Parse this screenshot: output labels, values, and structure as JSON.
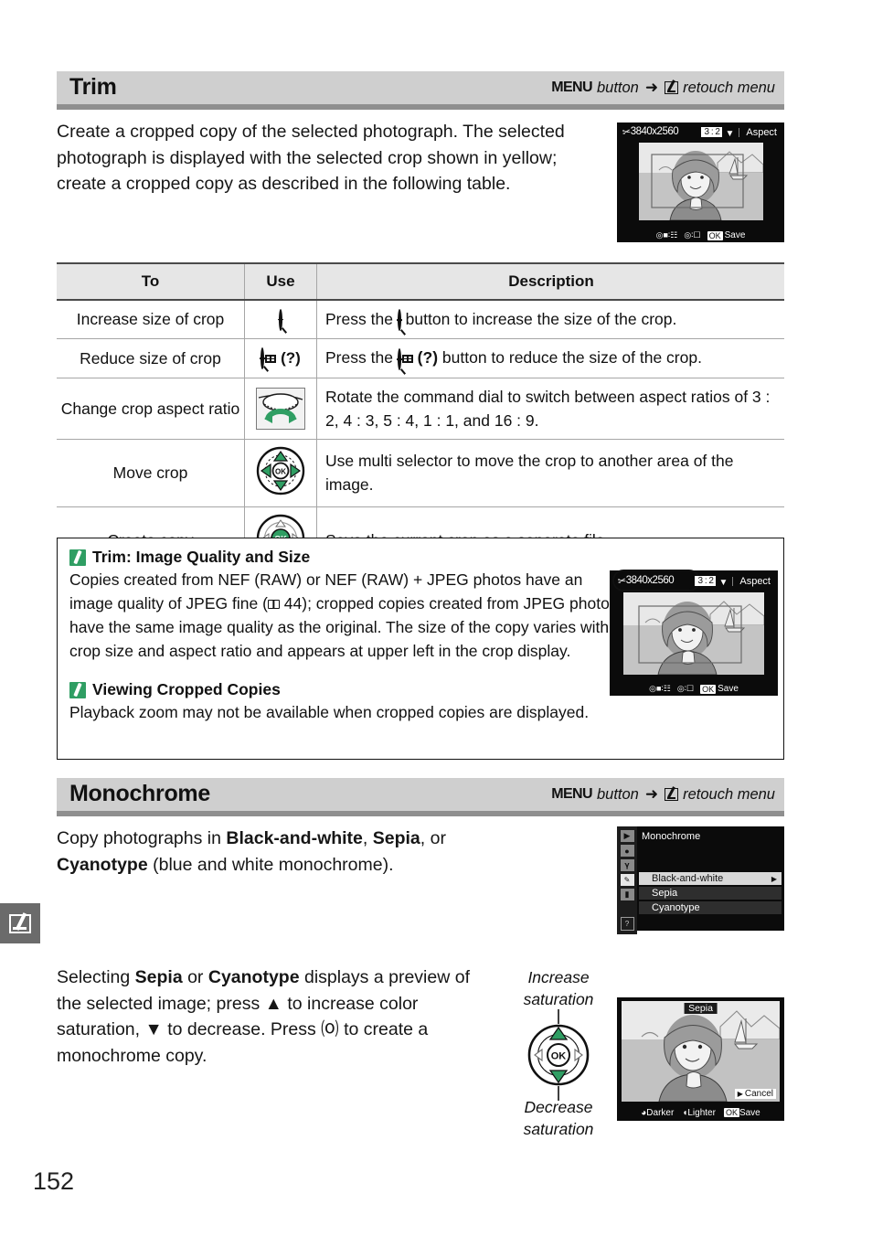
{
  "page": {
    "number": "152"
  },
  "sections": [
    {
      "title": "Trim",
      "route": {
        "menu": "MENU",
        "button_word": "button",
        "arrow": "➜",
        "target": "retouch menu"
      },
      "intro": "Create a cropped copy of the selected photograph.  The selected photograph is displayed with the selected crop shown in yellow; create a cropped copy as described in the following table."
    },
    {
      "title": "Monochrome",
      "route": {
        "menu": "MENU",
        "button_word": "button",
        "arrow": "➜",
        "target": "retouch menu"
      },
      "intro_pre": "Copy photographs in ",
      "intro_b1": "Black-and-white",
      "intro_mid1": ", ",
      "intro_b2": "Sepia",
      "intro_mid2": ", or ",
      "intro_b3": "Cyanotype",
      "intro_post": " (blue and white monochrome).",
      "second_pre": "Selecting ",
      "second_b1": "Sepia",
      "second_mid1": " or ",
      "second_b2": "Cyanotype",
      "second_post": " displays a preview of the selected image; press ▲ to increase color saturation, ▼ to decrease.  Press ⒪ to create a monochrome copy."
    }
  ],
  "table": {
    "headers": [
      "To",
      "Use",
      "Description"
    ],
    "rows": [
      {
        "to": "Increase size of crop",
        "use_icon": "zoom-in-icon",
        "use_label": "",
        "description_pre": "Press the ",
        "description_post": " button to increase the size of the crop."
      },
      {
        "to": "Reduce size of crop",
        "use_icon": "zoom-out-help-icon",
        "use_label": "(?)",
        "description_pre": "Press the ",
        "description_post": " button to reduce the size of the crop."
      },
      {
        "to": "Change crop aspect ratio",
        "use_icon": "command-dial-icon",
        "use_label": "",
        "description_pre": "Rotate the command dial to switch between aspect ratios of 3 : 2, 4 : 3, 5 : 4, 1 : 1, and 16 : 9.",
        "description_post": ""
      },
      {
        "to": "Move crop",
        "use_icon": "multi-selector-arrows-icon",
        "use_label": "",
        "description_pre": "Use multi selector to move the crop to another area of the image.",
        "description_post": ""
      },
      {
        "to": "Create copy",
        "use_icon": "multi-selector-ok-icon",
        "use_label": "",
        "description_pre": "Save the current crop as a separate file.",
        "description_post": ""
      }
    ]
  },
  "notes": [
    {
      "icon": "pencil-note-icon",
      "title": "Trim: Image Quality and Size",
      "body_a": "Copies created from NEF (RAW) or NEF (RAW) + JPEG photos have an image quality of JPEG fine (",
      "ref": "44",
      "body_b": "); cropped copies created from JPEG photos have the same image quality as the original.  The size of the copy varies with crop size and aspect ratio and appears at upper left in the crop display."
    },
    {
      "icon": "pencil-note-icon",
      "title": "Viewing Cropped Copies",
      "body_a": "Playback zoom may not be available when cropped copies are displayed.",
      "ref": "",
      "body_b": ""
    }
  ],
  "screens": {
    "crop_display": {
      "name": "crop-display-screen",
      "size_text": "3840x2560",
      "ratio": "3 : 2",
      "aspect_label": "Aspect",
      "bottom_hints": [
        ": ",
        " : ",
        "Save"
      ],
      "bottom_ok": "OK"
    },
    "crop_display_highlight": {
      "name": "crop-display-screen-highlighted",
      "size_text": "3840x2560",
      "ratio": "3 : 2",
      "aspect_label": "Aspect",
      "bottom_ok": "OK",
      "bottom_save": "Save"
    },
    "monochrome_menu": {
      "name": "monochrome-menu-screen",
      "title": "Monochrome",
      "items": [
        "Black-and-white",
        "Sepia",
        "Cyanotype"
      ],
      "selected_index": 0
    },
    "sepia_preview": {
      "name": "sepia-preview-screen",
      "mode_label": "Sepia",
      "cancel_label": "Cancel",
      "darker_label": "Darker",
      "lighter_label": "Lighter",
      "save_label": "Save",
      "save_badge": "OK"
    }
  },
  "callouts": {
    "increase": "Increase\nsaturation",
    "increase_line1": "Increase",
    "increase_line2": "saturation",
    "decrease_line1": "Decrease",
    "decrease_line2": "saturation"
  },
  "colors": {
    "accent_green": "#2f9e63",
    "header_gray": "#cfcfcf",
    "header_shadow": "#8f8f8f",
    "table_header": "#e6e6e6",
    "lcd_black": "#0b0b0b"
  }
}
